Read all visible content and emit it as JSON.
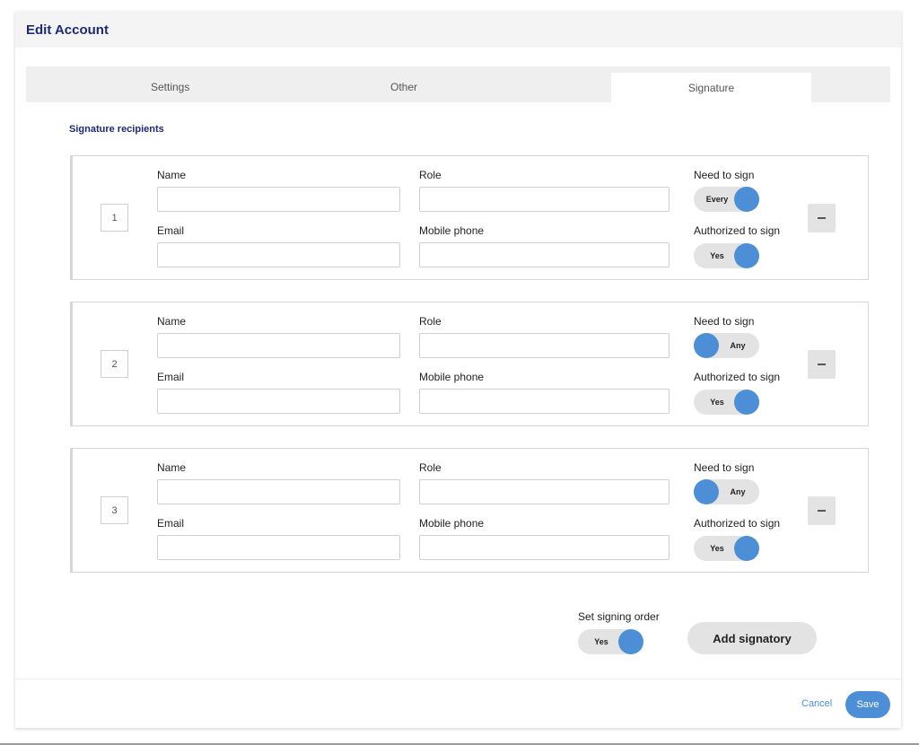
{
  "modal": {
    "title": "Edit Account"
  },
  "tabs": {
    "settings": "Settings",
    "other": "Other",
    "signature": "Signature"
  },
  "section_title": "Signature recipients",
  "labels": {
    "name": "Name",
    "role": "Role",
    "email": "Email",
    "mobile": "Mobile phone",
    "need_to_sign": "Need to sign",
    "authorized_to_sign": "Authorized to sign"
  },
  "recipients": [
    {
      "number": "1",
      "name": "",
      "role": "",
      "email": "",
      "mobile": "",
      "need_to_sign": "Every",
      "authorized_to_sign": "Yes"
    },
    {
      "number": "2",
      "name": "",
      "role": "",
      "email": "",
      "mobile": "",
      "need_to_sign": "Any",
      "authorized_to_sign": "Yes"
    },
    {
      "number": "3",
      "name": "",
      "role": "",
      "email": "",
      "mobile": "",
      "need_to_sign": "Any",
      "authorized_to_sign": "Yes"
    }
  ],
  "signing_order": {
    "label": "Set signing order",
    "value": "Yes"
  },
  "add_signatory": "Add signatory",
  "footer": {
    "cancel": "Cancel",
    "save": "Save"
  },
  "colors": {
    "accent": "#4d8fd6",
    "title": "#1c2a78",
    "toggle_track": "#e3e3e3"
  }
}
